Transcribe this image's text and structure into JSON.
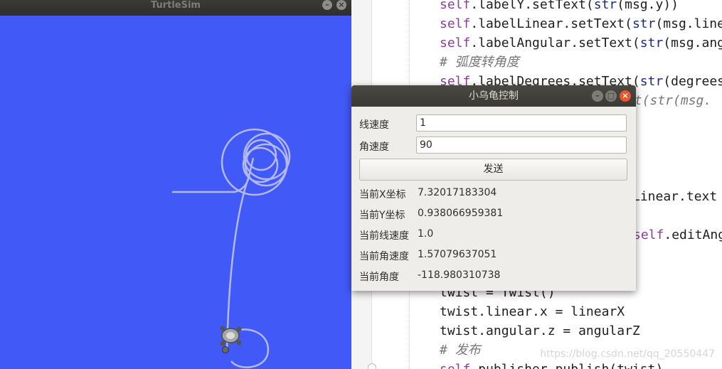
{
  "turtlesim": {
    "title": "TurtleSim",
    "background_color": "#4159f6",
    "path_color": "#b3b8f0"
  },
  "editor": {
    "lines": [
      {
        "parts": [
          {
            "t": "self",
            "c": "kw-self"
          },
          {
            "t": ".labelY.setText("
          },
          {
            "t": "str",
            "c": "kw-fn"
          },
          {
            "t": "(msg.y))"
          }
        ]
      },
      {
        "parts": [
          {
            "t": "self",
            "c": "kw-self"
          },
          {
            "t": ".labelLinear.setText("
          },
          {
            "t": "str",
            "c": "kw-fn"
          },
          {
            "t": "(msg.line"
          }
        ]
      },
      {
        "parts": [
          {
            "t": "self",
            "c": "kw-self"
          },
          {
            "t": ".labelAngular.setText("
          },
          {
            "t": "str",
            "c": "kw-fn"
          },
          {
            "t": "(msg.ang"
          }
        ]
      },
      {
        "parts": [
          {
            "t": "# 弧度转角度",
            "c": "cm"
          }
        ]
      },
      {
        "parts": [
          {
            "t": "self",
            "c": "kw-self"
          },
          {
            "t": ".labelDegrees.setText("
          },
          {
            "t": "str",
            "c": "kw-fn"
          },
          {
            "t": "(degrees"
          }
        ]
      },
      {
        "parts": [
          {
            "t": "xt(str(msg.",
            "c": "cm"
          }
        ]
      },
      {
        "parts": [
          {
            "t": "Linear.text"
          }
        ]
      },
      {
        "parts": [
          {
            "t": "self",
            "c": "kw-self"
          },
          {
            "t": ".editAng"
          }
        ]
      },
      {
        "parts": [
          {
            "t": "twist = Twist()"
          }
        ]
      },
      {
        "parts": [
          {
            "t": "twist.linear.x = linearX"
          }
        ]
      },
      {
        "parts": [
          {
            "t": "twist.angular.z = angularZ"
          }
        ]
      },
      {
        "parts": [
          {
            "t": "# 发布",
            "c": "cm"
          }
        ]
      },
      {
        "parts": [
          {
            "t": "self",
            "c": "kw-self"
          },
          {
            "t": ".publisher.publish(twist)"
          }
        ]
      }
    ],
    "watermark": "https://blog.csdn.net/qq_20550447"
  },
  "dialog": {
    "title": "小乌龟控制",
    "linear_label": "线速度",
    "linear_value": "1",
    "angular_label": "角速度",
    "angular_value": "90",
    "send_label": "发送",
    "status": [
      {
        "label": "当前X坐标",
        "value": "7.32017183304"
      },
      {
        "label": "当前Y坐标",
        "value": "0.938066959381"
      },
      {
        "label": "当前线速度",
        "value": "1.0"
      },
      {
        "label": "当前角速度",
        "value": "1.57079637051"
      },
      {
        "label": "当前角度",
        "value": "-118.980310738"
      }
    ],
    "close_color": "#e8582c"
  }
}
